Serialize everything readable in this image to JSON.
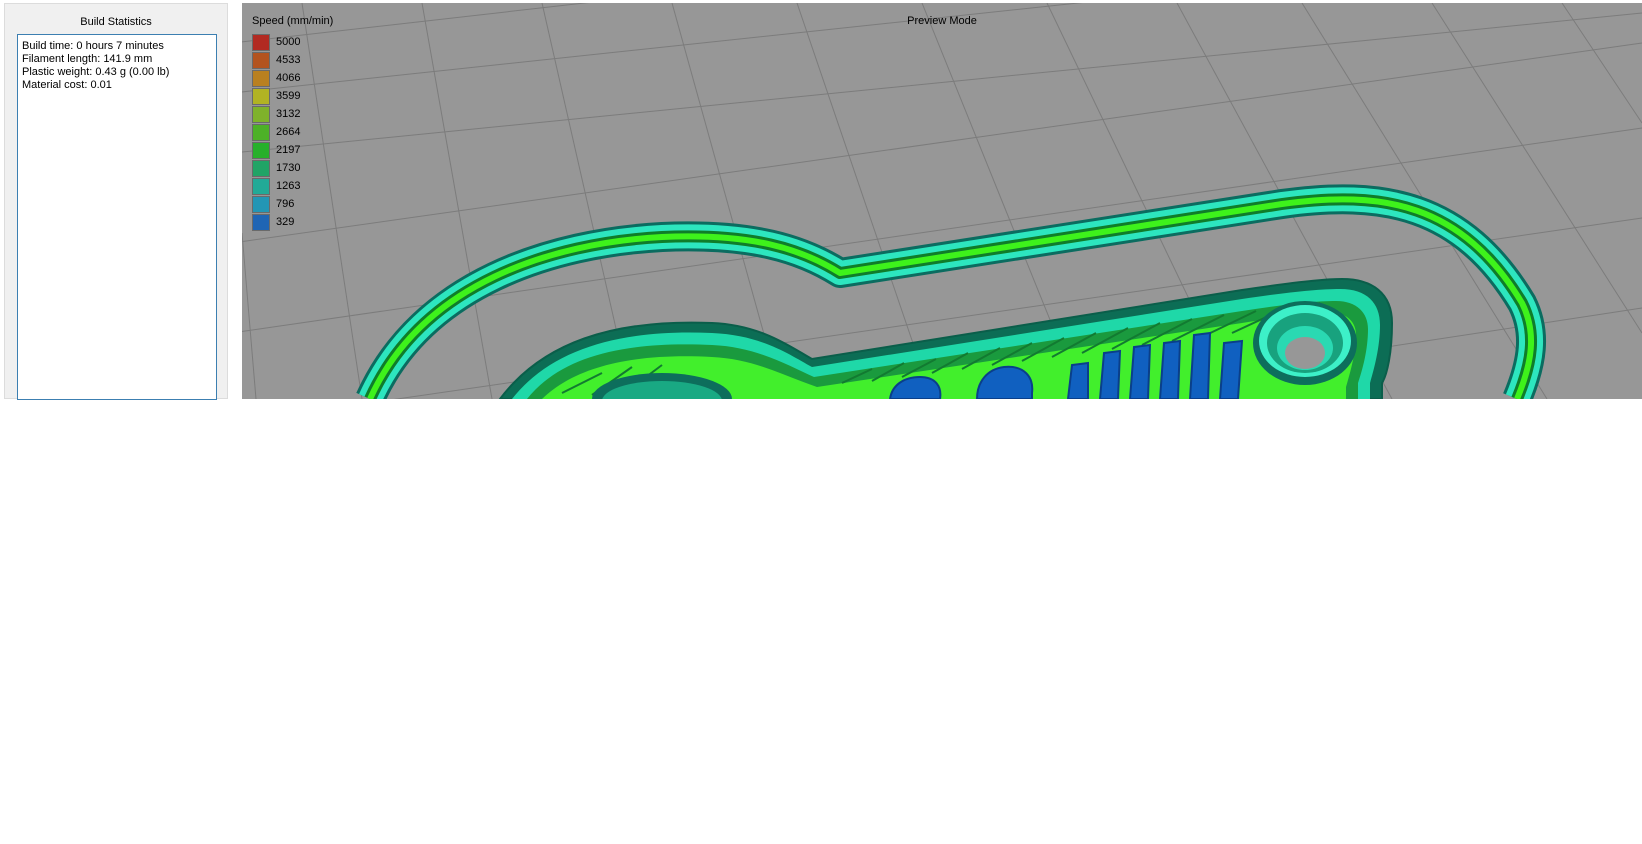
{
  "stats_panel": {
    "title": "Build Statistics",
    "lines": [
      "Build time: 0 hours 7 minutes",
      "Filament length: 141.9 mm",
      "Plastic weight: 0.43 g (0.00 lb)",
      "Material cost: 0.01"
    ]
  },
  "viewport": {
    "mode_label": "Preview Mode",
    "background_color": "#979797",
    "legend": {
      "title": "Speed (mm/min)",
      "items": [
        {
          "value": "5000",
          "color": "#b22a22"
        },
        {
          "value": "4533",
          "color": "#b3531f"
        },
        {
          "value": "4066",
          "color": "#b98020"
        },
        {
          "value": "3599",
          "color": "#b1b323"
        },
        {
          "value": "3132",
          "color": "#7fb22b"
        },
        {
          "value": "2664",
          "color": "#4db127"
        },
        {
          "value": "2197",
          "color": "#27b02b"
        },
        {
          "value": "1730",
          "color": "#21a466"
        },
        {
          "value": "1263",
          "color": "#22aa97"
        },
        {
          "value": "796",
          "color": "#2396b5"
        },
        {
          "value": "329",
          "color": "#1f65b4"
        }
      ]
    }
  }
}
